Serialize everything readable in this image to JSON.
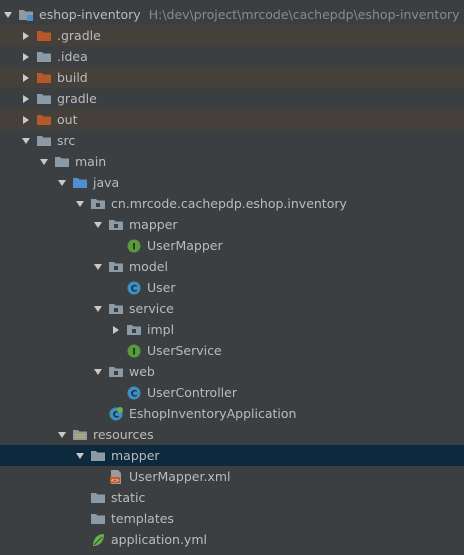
{
  "project": {
    "name": "eshop-inventory",
    "path": "H:\\dev\\project\\mrcode\\cachepdp\\eshop-inventory"
  },
  "tree": [
    {
      "label": "eshop-inventory",
      "arrow": "expanded",
      "icon": "module-folder-icon",
      "depth": 0,
      "root": true
    },
    {
      "label": ".gradle",
      "arrow": "collapsed",
      "icon": "excluded-folder-icon",
      "depth": 1,
      "style": "excluded"
    },
    {
      "label": ".idea",
      "arrow": "collapsed",
      "icon": "folder-icon",
      "depth": 1
    },
    {
      "label": "build",
      "arrow": "collapsed",
      "icon": "excluded-folder-icon",
      "depth": 1,
      "style": "excluded"
    },
    {
      "label": "gradle",
      "arrow": "collapsed",
      "icon": "folder-icon",
      "depth": 1
    },
    {
      "label": "out",
      "arrow": "collapsed",
      "icon": "excluded-folder-icon",
      "depth": 1,
      "style": "excluded"
    },
    {
      "label": "src",
      "arrow": "expanded",
      "icon": "folder-icon",
      "depth": 1
    },
    {
      "label": "main",
      "arrow": "expanded",
      "icon": "folder-icon",
      "depth": 2
    },
    {
      "label": "java",
      "arrow": "expanded",
      "icon": "source-folder-icon",
      "depth": 3
    },
    {
      "label": "cn.mrcode.cachepdp.eshop.inventory",
      "arrow": "expanded",
      "icon": "package-icon",
      "depth": 4
    },
    {
      "label": "mapper",
      "arrow": "expanded",
      "icon": "package-icon",
      "depth": 5
    },
    {
      "label": "UserMapper",
      "arrow": "none",
      "icon": "interface-icon",
      "depth": 6
    },
    {
      "label": "model",
      "arrow": "expanded",
      "icon": "package-icon",
      "depth": 5
    },
    {
      "label": "User",
      "arrow": "none",
      "icon": "class-icon",
      "depth": 6
    },
    {
      "label": "service",
      "arrow": "expanded",
      "icon": "package-icon",
      "depth": 5
    },
    {
      "label": "impl",
      "arrow": "collapsed",
      "icon": "package-icon",
      "depth": 6
    },
    {
      "label": "UserService",
      "arrow": "none",
      "icon": "interface-icon",
      "depth": 6
    },
    {
      "label": "web",
      "arrow": "expanded",
      "icon": "package-icon",
      "depth": 5
    },
    {
      "label": "UserController",
      "arrow": "none",
      "icon": "class-icon",
      "depth": 6
    },
    {
      "label": "EshopInventoryApplication",
      "arrow": "none",
      "icon": "spring-class-icon",
      "depth": 5
    },
    {
      "label": "resources",
      "arrow": "expanded",
      "icon": "resources-folder-icon",
      "depth": 3
    },
    {
      "label": "mapper",
      "arrow": "expanded",
      "icon": "folder-icon",
      "depth": 4,
      "style": "selected"
    },
    {
      "label": "UserMapper.xml",
      "arrow": "none",
      "icon": "xml-file-icon",
      "depth": 5
    },
    {
      "label": "static",
      "arrow": "none",
      "icon": "folder-icon",
      "depth": 4
    },
    {
      "label": "templates",
      "arrow": "none",
      "icon": "folder-icon",
      "depth": 4
    },
    {
      "label": "application.yml",
      "arrow": "none",
      "icon": "spring-config-icon",
      "depth": 4
    }
  ],
  "colors": {
    "background": "#3c3f41",
    "excluded_row": "#45403a",
    "selected_row": "#0d293e",
    "excluded_folder": "#b5592b",
    "folder": "#8c9aa6",
    "source_folder": "#4f8fd0",
    "class_circle": "#3d8fc1",
    "interface_circle": "#5a9a3e",
    "spring": "#6ab04c"
  }
}
